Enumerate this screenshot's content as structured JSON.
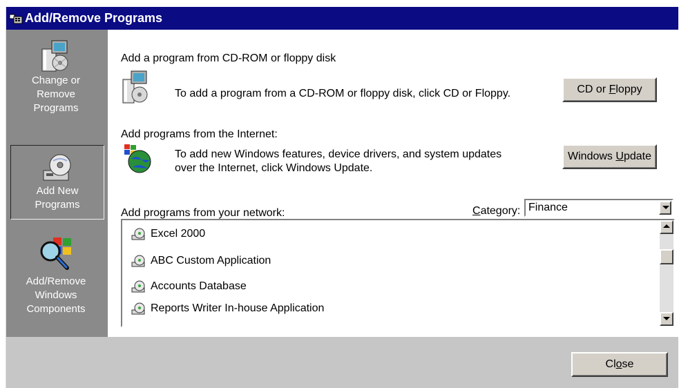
{
  "window": {
    "title": "Add/Remove Programs",
    "title_icon": "programs-window-icon"
  },
  "sidebar": {
    "items": [
      {
        "label_line1": "Change or",
        "label_line2": "Remove",
        "label_line3": "Programs",
        "icon": "change-remove-icon",
        "selected": false
      },
      {
        "label_line1": "Add New",
        "label_line2": "Programs",
        "icon": "add-new-programs-icon",
        "selected": true
      },
      {
        "label_line1": "Add/Remove",
        "label_line2": "Windows",
        "label_line3": "Components",
        "icon": "windows-components-icon",
        "selected": false
      }
    ]
  },
  "cd_section": {
    "heading": "Add a program from CD-ROM or floppy disk",
    "description": "To add a program from a CD-ROM or floppy disk, click CD or Floppy.",
    "button_pre": "CD or ",
    "button_underlined": "F",
    "button_post": "loppy",
    "icon": "cd-install-icon"
  },
  "internet_section": {
    "heading": "Add programs from the Internet:",
    "description_line1": "To add new Windows features, device drivers, and system updates",
    "description_line2": "over the Internet, click Windows Update.",
    "button_pre": "Windows ",
    "button_underlined": "U",
    "button_post": "pdate",
    "icon": "windows-update-globe-icon"
  },
  "network_section": {
    "heading": "Add programs from your network:",
    "category_label_underlined": "C",
    "category_label_rest": "ategory:",
    "category_value": "Finance",
    "items": [
      "Excel 2000",
      "ABC Custom Application",
      "Accounts Database",
      "Reports Writer In-house Application"
    ]
  },
  "footer": {
    "close_pre": "Cl",
    "close_underlined": "o",
    "close_post": "se"
  },
  "colors": {
    "titlebar": "#0b0b84",
    "sidebar": "#8a8a8a",
    "button_face": "#d4d0c8"
  }
}
